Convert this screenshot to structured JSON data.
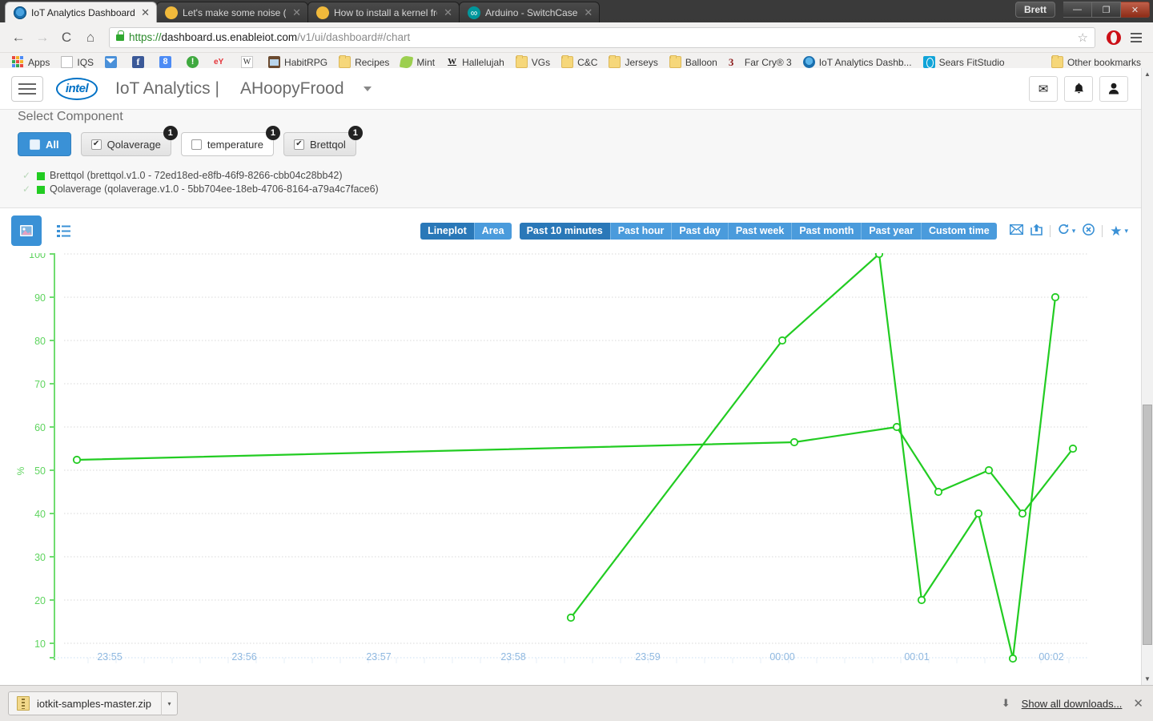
{
  "window": {
    "user_chip": "Brett",
    "minimize": "—",
    "restore": "❐",
    "close": "✕"
  },
  "tabs": [
    {
      "title": "IoT Analytics Dashboard",
      "favicon": "iot-globe-icon",
      "active": true,
      "close": "✕"
    },
    {
      "title": "Let's make some noise (or",
      "favicon": "moon-icon",
      "active": false,
      "close": "✕"
    },
    {
      "title": "How to install a kernel fro",
      "favicon": "moon-icon",
      "active": false,
      "close": "✕"
    },
    {
      "title": "Arduino - SwitchCase",
      "favicon": "arduino-icon",
      "active": false,
      "close": "✕"
    }
  ],
  "toolbar": {
    "back": "←",
    "forward": "→",
    "reload": "C",
    "home": "⌂",
    "url_scheme": "https://",
    "url_host": "dashboard.us.enableiot.com",
    "url_path": "/v1/ui/dashboard#/chart",
    "bookmark_star": "☆",
    "opera_icon": "opera-icon",
    "menu_icon": "hamburger-menu-icon"
  },
  "bookmarks": {
    "items": [
      {
        "label": "Apps",
        "icon": "apps-grid-icon"
      },
      {
        "label": "IQS",
        "icon": "document-icon"
      },
      {
        "label": "",
        "icon": "mail-icon"
      },
      {
        "label": "",
        "icon": "facebook-icon"
      },
      {
        "label": "",
        "icon": "google-plus-icon"
      },
      {
        "label": "",
        "icon": "green-exclaim-icon"
      },
      {
        "label": "",
        "icon": "ebay-icon"
      },
      {
        "label": "",
        "icon": "wikipedia-icon"
      },
      {
        "label": "HabitRPG",
        "icon": "habitrpg-icon"
      },
      {
        "label": "Recipes",
        "icon": "folder-icon"
      },
      {
        "label": "Mint",
        "icon": "mint-leaf-icon"
      },
      {
        "label": "Hallelujah",
        "icon": "w-bold-icon"
      },
      {
        "label": "VGs",
        "icon": "folder-icon"
      },
      {
        "label": "C&C",
        "icon": "folder-icon"
      },
      {
        "label": "Jerseys",
        "icon": "folder-icon"
      },
      {
        "label": "Balloon",
        "icon": "folder-icon"
      },
      {
        "label": "Far Cry® 3",
        "icon": "farcry3-icon"
      },
      {
        "label": "IoT Analytics Dashb...",
        "icon": "iot-globe-icon"
      },
      {
        "label": "Sears FitStudio",
        "icon": "sears-icon"
      }
    ],
    "other": {
      "label": "Other bookmarks",
      "icon": "folder-icon"
    }
  },
  "navbar": {
    "hamburger": "menu-icon",
    "logo": "intel",
    "brand": "IoT Analytics |",
    "account": "AHoopyFrood",
    "caret": "▾",
    "icons": [
      {
        "name": "messages-icon",
        "glyph": "✉"
      },
      {
        "name": "notifications-icon",
        "glyph": "🔔"
      },
      {
        "name": "profile-icon",
        "glyph": "👤"
      }
    ]
  },
  "select_component": {
    "title": "Select Component",
    "chips": [
      {
        "label": "All",
        "checked": false,
        "badge": "",
        "style": "all"
      },
      {
        "label": "Qolaverage",
        "checked": true,
        "badge": "1",
        "style": "on"
      },
      {
        "label": "temperature",
        "checked": false,
        "badge": "1",
        "style": "off"
      },
      {
        "label": "Brettqol",
        "checked": true,
        "badge": "1",
        "style": "on"
      }
    ],
    "devices": [
      {
        "tick": "✓",
        "color": "#22cc22",
        "label": "Brettqol (brettqol.v1.0 - 72ed18ed-e8fb-46f9-8266-cbb04c28bb42)"
      },
      {
        "tick": "✓",
        "color": "#22cc22",
        "label": "Qolaverage (qolaverage.v1.0 - 5bb704ee-18eb-4706-8164-a79a4c7face6)"
      }
    ]
  },
  "chart_toolbar": {
    "view_image_icon": "image-view-icon",
    "view_list_icon": "list-view-icon",
    "plot_types": [
      {
        "label": "Lineplot",
        "selected": true
      },
      {
        "label": "Area",
        "selected": false
      }
    ],
    "ranges": [
      {
        "label": "Past 10 minutes",
        "selected": true
      },
      {
        "label": "Past hour",
        "selected": false
      },
      {
        "label": "Past day",
        "selected": false
      },
      {
        "label": "Past week",
        "selected": false
      },
      {
        "label": "Past month",
        "selected": false
      },
      {
        "label": "Past year",
        "selected": false
      },
      {
        "label": "Custom time",
        "selected": false
      }
    ],
    "icons": [
      {
        "name": "email-export-icon",
        "glyph": "✉"
      },
      {
        "name": "share-export-icon",
        "glyph": "⤴"
      },
      {
        "name": "refresh-icon",
        "glyph": "⟳"
      },
      {
        "name": "refresh-caret-icon",
        "glyph": "▾"
      },
      {
        "name": "stop-refresh-icon",
        "glyph": "⊗"
      },
      {
        "name": "favorite-star-icon",
        "glyph": "★"
      },
      {
        "name": "favorite-caret-icon",
        "glyph": "▾"
      }
    ]
  },
  "chart_data": {
    "type": "line",
    "title": "",
    "xlabel": "",
    "ylabel": "%",
    "ylim": [
      0,
      100
    ],
    "yticks": [
      10,
      20,
      30,
      40,
      50,
      60,
      70,
      80,
      90,
      100
    ],
    "xticks": [
      "23:55",
      "23:56",
      "23:57",
      "23:58",
      "23:59",
      "00:00",
      "00:01",
      "00:02"
    ],
    "grid": true,
    "legend_position": "none",
    "line_color": "#22cc22",
    "axis_color": "#6fdc6f",
    "tick_label_color": "#8fb8e0",
    "series": [
      {
        "name": "Qolaverage",
        "color": "#22cc22",
        "x": [
          "23:55.0",
          "23:59.8",
          "00:00.6",
          "00:00.95",
          "00:01.5"
        ],
        "points": [
          {
            "t": "23:55",
            "v": 52
          },
          {
            "t": "23:59:50",
            "v": 56
          },
          {
            "t": "00:00:40",
            "v": 60
          },
          {
            "t": "00:01:05",
            "v": 44
          },
          {
            "t": "00:01:33",
            "v": 48
          },
          {
            "t": "00:01:50",
            "v": 40.5
          },
          {
            "t": "00:02:10",
            "v": 58
          }
        ]
      },
      {
        "name": "Brettqol",
        "color": "#22cc22",
        "points": [
          {
            "t": "23:58:20",
            "v": 8
          },
          {
            "t": "23:59:50",
            "v": 80
          },
          {
            "t": "00:00:35",
            "v": 100
          },
          {
            "t": "00:00:55",
            "v": 20
          },
          {
            "t": "00:01:25",
            "v": 40
          },
          {
            "t": "00:01:45",
            "v": 0
          },
          {
            "t": "00:02:05",
            "v": 90
          }
        ]
      }
    ]
  },
  "download_bar": {
    "file_name": "iotkit-samples-master.zip",
    "file_icon": "zip-file-icon",
    "caret": "▾",
    "down_arrow": "⬇",
    "show_all": "Show all downloads...",
    "close": "✕"
  },
  "scrollbar": {
    "up": "▲",
    "down": "▼"
  }
}
